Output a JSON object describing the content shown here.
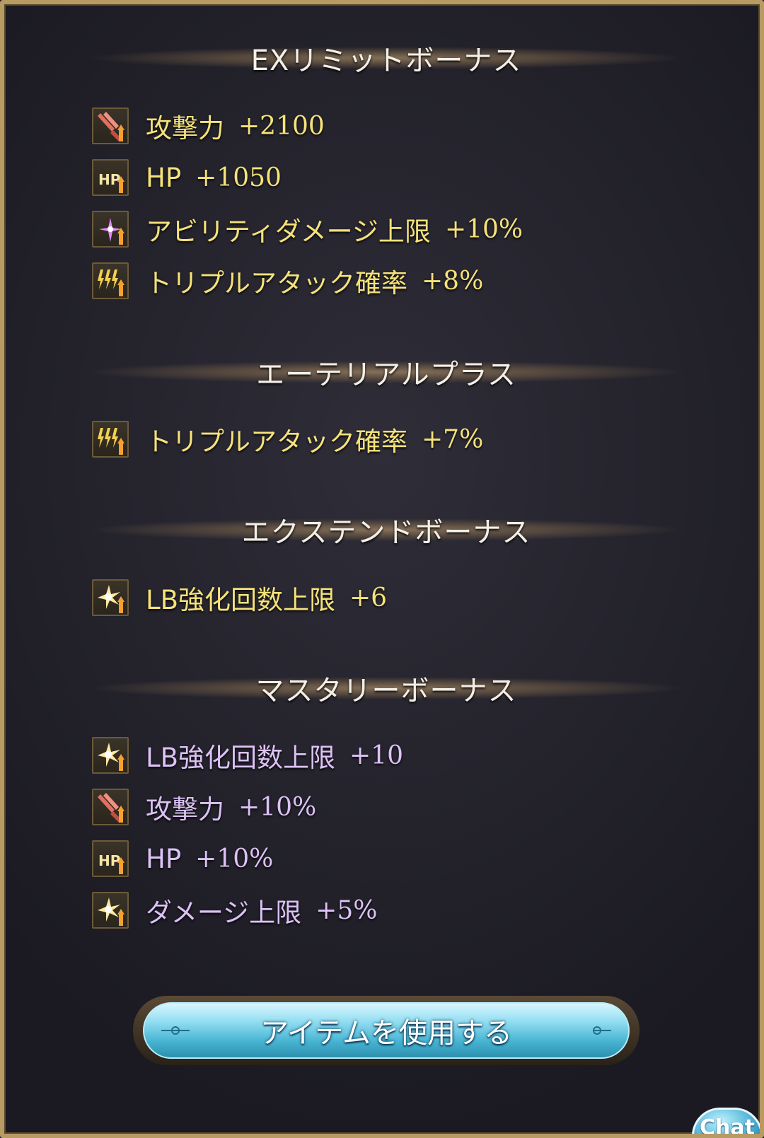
{
  "sections": [
    {
      "title": "EXリミットボーナス",
      "items": [
        {
          "icon": "attack-up-icon",
          "label": "攻撃力",
          "value": "+2100"
        },
        {
          "icon": "hp-up-icon",
          "label": "HP",
          "value": "+1050"
        },
        {
          "icon": "ability-damage-cap-up-icon",
          "label": "アビリティダメージ上限",
          "value": "+10%"
        },
        {
          "icon": "triple-attack-up-icon",
          "label": "トリプルアタック確率",
          "value": "+8%"
        }
      ]
    },
    {
      "title": "エーテリアルプラス",
      "items": [
        {
          "icon": "triple-attack-up-icon",
          "label": "トリプルアタック確率",
          "value": "+7%"
        }
      ]
    },
    {
      "title": "エクステンドボーナス",
      "items": [
        {
          "icon": "limit-break-up-icon",
          "label": "LB強化回数上限",
          "value": "+6"
        }
      ]
    },
    {
      "title": "マスタリーボーナス",
      "items": [
        {
          "icon": "limit-break-up-icon",
          "label": "LB強化回数上限",
          "value": "+10"
        },
        {
          "icon": "attack-up-icon",
          "label": "攻撃力",
          "value": "+10%"
        },
        {
          "icon": "hp-up-icon",
          "label": "HP",
          "value": "+10%"
        },
        {
          "icon": "damage-cap-up-icon",
          "label": "ダメージ上限",
          "value": "+5%"
        }
      ]
    }
  ],
  "use_item_button": "アイテムを使用する",
  "chat_button": "Chat",
  "colors": {
    "frame_border": "#b89a63",
    "panel_bg": "#24232c",
    "text_yellow": "#f5e27a",
    "text_purple": "#dcc2f5",
    "button_cyan": "#47b5d2"
  }
}
